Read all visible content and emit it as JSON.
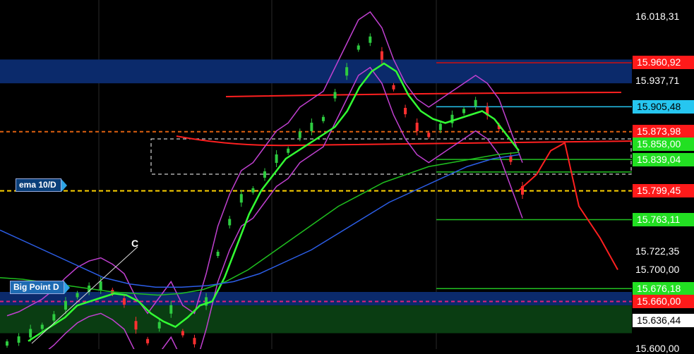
{
  "chart_data": {
    "type": "line",
    "instrument_range": [
      15.6,
      16.04
    ],
    "y_ticks": [
      "16.018,31",
      "15.937,71",
      "15.722,35",
      "15.700,00",
      "15.600,00"
    ],
    "price_tags": [
      {
        "text": "15.960,92",
        "value": 15.9609,
        "bg": "#ff1a1a",
        "fg": "#ffffff"
      },
      {
        "text": "15.905,48",
        "value": 15.9055,
        "bg": "#26c6f0",
        "fg": "#000000"
      },
      {
        "text": "15.873,98",
        "value": 15.874,
        "bg": "#ff1a1a",
        "fg": "#ffffff"
      },
      {
        "text": "15.858,00",
        "value": 15.858,
        "bg": "#22e022",
        "fg": "#ffffff"
      },
      {
        "text": "15.839,04",
        "value": 15.839,
        "bg": "#22e022",
        "fg": "#ffffff"
      },
      {
        "text": "15.799,45",
        "value": 15.7995,
        "bg": "#ff1a1a",
        "fg": "#ffffff"
      },
      {
        "text": "15.763,11",
        "value": 15.7631,
        "bg": "#22e022",
        "fg": "#ffffff"
      },
      {
        "text": "15.676,18",
        "value": 15.6762,
        "bg": "#22e022",
        "fg": "#ffffff"
      },
      {
        "text": "15.660,00",
        "value": 15.66,
        "bg": "#ff1a1a",
        "fg": "#ffffff"
      },
      {
        "text": "15.636,44",
        "value": 15.6364,
        "bg": "#ffffff",
        "fg": "#000000"
      }
    ],
    "annotations": [
      "ema 10/D",
      "Big Point D",
      "C"
    ],
    "zones": [
      {
        "from": 15.935,
        "to": 15.965,
        "color": "#0b2a6b"
      },
      {
        "from": 15.655,
        "to": 15.672,
        "color": "#0b2a6b"
      },
      {
        "from": 15.62,
        "to": 15.655,
        "color": "#0a3d12"
      }
    ],
    "price_series": [
      15.607,
      15.612,
      15.62,
      15.628,
      15.64,
      15.655,
      15.668,
      15.676,
      15.68,
      15.672,
      15.66,
      15.63,
      15.61,
      15.63,
      15.65,
      15.62,
      15.61,
      15.66,
      15.72,
      15.76,
      15.79,
      15.8,
      15.82,
      15.84,
      15.85,
      15.87,
      15.88,
      15.89,
      15.92,
      15.95,
      15.98,
      15.99,
      15.97,
      15.93,
      15.9,
      15.88,
      15.87,
      15.88,
      15.89,
      15.9,
      15.91,
      15.9,
      15.88,
      15.84,
      15.8
    ],
    "ema_green": [
      15.61,
      15.62,
      15.63,
      15.64,
      15.655,
      15.66,
      15.665,
      15.67,
      15.668,
      15.66,
      15.645,
      15.635,
      15.628,
      15.64,
      15.655,
      15.66,
      15.69,
      15.73,
      15.77,
      15.8,
      15.82,
      15.84,
      15.85,
      15.86,
      15.87,
      15.88,
      15.9,
      15.93,
      15.95,
      15.96,
      15.95,
      15.92,
      15.9,
      15.89,
      15.885,
      15.89,
      15.895,
      15.9,
      15.89,
      15.87,
      15.85
    ],
    "ema_slow_green": [
      15.69,
      15.688,
      15.684,
      15.68,
      15.676,
      15.672,
      15.67,
      15.668,
      15.67,
      15.675,
      15.685,
      15.7,
      15.72,
      15.74,
      15.76,
      15.78,
      15.795,
      15.81,
      15.82,
      15.83,
      15.835,
      15.84,
      15.845,
      15.848
    ],
    "ema_blue": [
      15.75,
      15.735,
      15.72,
      15.705,
      15.69,
      15.682,
      15.678,
      15.678,
      15.68,
      15.685,
      15.695,
      15.71,
      15.725,
      15.745,
      15.765,
      15.785,
      15.8,
      15.815,
      15.83,
      15.84,
      15.845
    ],
    "forecast_red": [
      15.8,
      15.82,
      15.85,
      15.86,
      15.78,
      15.74,
      15.7
    ]
  }
}
